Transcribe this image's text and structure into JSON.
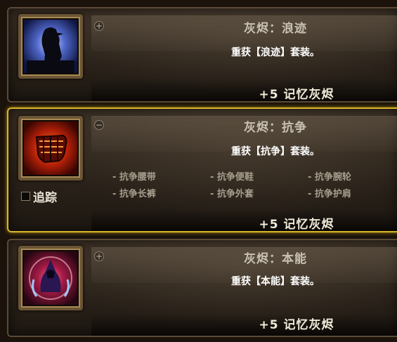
{
  "sets": [
    {
      "toggle": "+",
      "title": "灰烬：浪迹",
      "description": "重获【浪迹】套装。",
      "reward": "+5 记忆灰烬",
      "icon": "crow-moon-icon"
    },
    {
      "toggle": "−",
      "title": "灰烬：抗争",
      "description": "重获【抗争】套装。",
      "reward": "+5 记忆灰烬",
      "icon": "fist-icon",
      "track_label": "追踪",
      "pieces": [
        "- 抗争腰带",
        "- 抗争便鞋",
        "- 抗争腕轮",
        "- 抗争长裤",
        "- 抗争外套",
        "- 抗争护肩"
      ]
    },
    {
      "toggle": "+",
      "title": "灰烬：本能",
      "description": "重获【本能】套装。",
      "reward": "+5 记忆灰烬",
      "icon": "hooded-figure-icon"
    }
  ],
  "colors": {
    "active_border": "#d9b62a",
    "title_text": "#c9c2b4",
    "piece_text": "#a79e8e"
  }
}
